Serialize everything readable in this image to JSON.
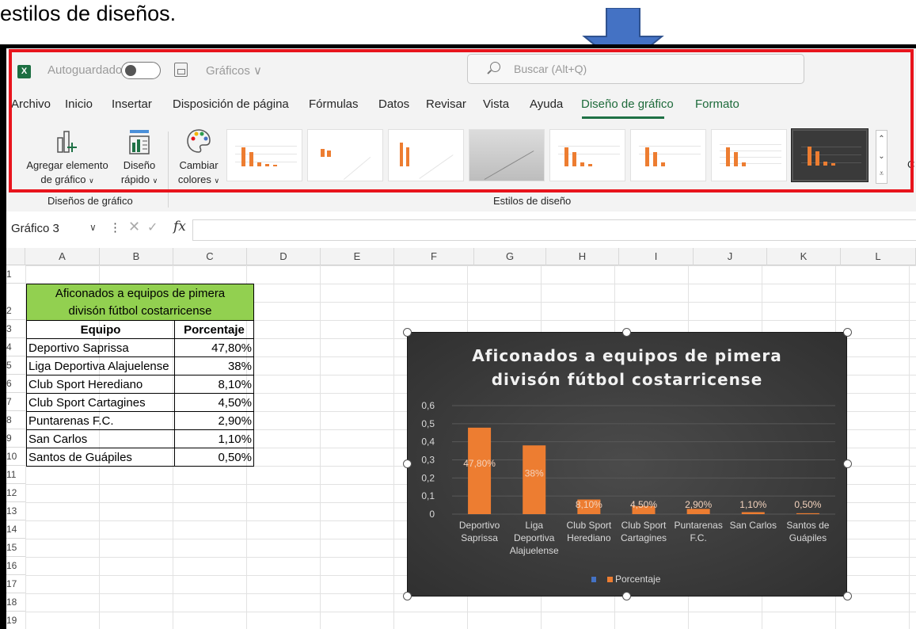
{
  "caption": "estilos de diseños.",
  "window": {
    "autosave_label": "Autoguardado",
    "doc_title": "Gráficos ∨",
    "search_placeholder": "Buscar (Alt+Q)",
    "logo_text": "X"
  },
  "tabs": [
    {
      "label": "Archivo"
    },
    {
      "label": "Inicio"
    },
    {
      "label": "Insertar"
    },
    {
      "label": "Disposición de página"
    },
    {
      "label": "Fórmulas"
    },
    {
      "label": "Datos"
    },
    {
      "label": "Revisar"
    },
    {
      "label": "Vista"
    },
    {
      "label": "Ayuda"
    },
    {
      "label": "Diseño de gráfico",
      "active": true
    },
    {
      "label": "Formato"
    }
  ],
  "ribbon": {
    "add_element_line1": "Agregar elemento",
    "add_element_line2": "de gráfico",
    "quick_layout_line1": "Diseño",
    "quick_layout_line2": "rápido",
    "change_colors_line1": "Cambiar",
    "change_colors_line2": "colores",
    "group_layouts": "Diseños de gráfico",
    "group_styles": "Estilos de diseño",
    "cut_label": "C"
  },
  "formula_bar": {
    "name_box": "Gráfico 3",
    "fx": "fx"
  },
  "columns": [
    "A",
    "B",
    "C",
    "D",
    "E",
    "F",
    "G",
    "H",
    "I",
    "J",
    "K",
    "L"
  ],
  "rows": [
    "1",
    "2",
    "3",
    "4",
    "5",
    "6",
    "7",
    "8",
    "9",
    "10",
    "11",
    "12",
    "13",
    "14",
    "15",
    "16",
    "17",
    "18",
    "19"
  ],
  "table": {
    "title_line1": "Aficonados a equipos de pimera",
    "title_line2": "divisón fútbol costarricense",
    "header_team": "Equipo",
    "header_pct": "Porcentaje",
    "rows": [
      {
        "team": "Deportivo Saprissa",
        "pct": "47,80%"
      },
      {
        "team": "Liga Deportiva Alajuelense",
        "pct": "38%"
      },
      {
        "team": "Club Sport Herediano",
        "pct": "8,10%"
      },
      {
        "team": "Club Sport Cartagines",
        "pct": "4,50%"
      },
      {
        "team": "Puntarenas F.C.",
        "pct": "2,90%"
      },
      {
        "team": "San Carlos",
        "pct": "1,10%"
      },
      {
        "team": "Santos de Guápiles",
        "pct": "0,50%"
      }
    ]
  },
  "colors": {
    "accent_green": "#1e6b3b",
    "bar_orange": "#ed7d31",
    "highlight_red": "#e8141c",
    "arrow_blue": "#4472c4",
    "table_title_green": "#92d050"
  },
  "chart_data": {
    "type": "bar",
    "title_line1": "Aficonados a equipos de pimera",
    "title_line2": "divisón fútbol costarricense",
    "categories": [
      [
        "Deportivo",
        "Saprissa"
      ],
      [
        "Liga",
        "Deportiva",
        "Alajuelense"
      ],
      [
        "Club Sport",
        "Herediano"
      ],
      [
        "Club Sport",
        "Cartagines"
      ],
      [
        "Puntarenas",
        "F.C."
      ],
      [
        "San Carlos"
      ],
      [
        "Santos de",
        "Guápiles"
      ]
    ],
    "series": [
      {
        "name": "Porcentaje",
        "values": [
          0.478,
          0.38,
          0.081,
          0.045,
          0.029,
          0.011,
          0.005
        ],
        "labels": [
          "47,80%",
          "38%",
          "8,10%",
          "4,50%",
          "2,90%",
          "1,10%",
          "0,50%"
        ]
      }
    ],
    "yticks": [
      "0",
      "0,1",
      "0,2",
      "0,3",
      "0,4",
      "0,5",
      "0,6"
    ],
    "ylim": [
      0,
      0.6
    ],
    "grid": true,
    "legend_position": "bottom"
  }
}
